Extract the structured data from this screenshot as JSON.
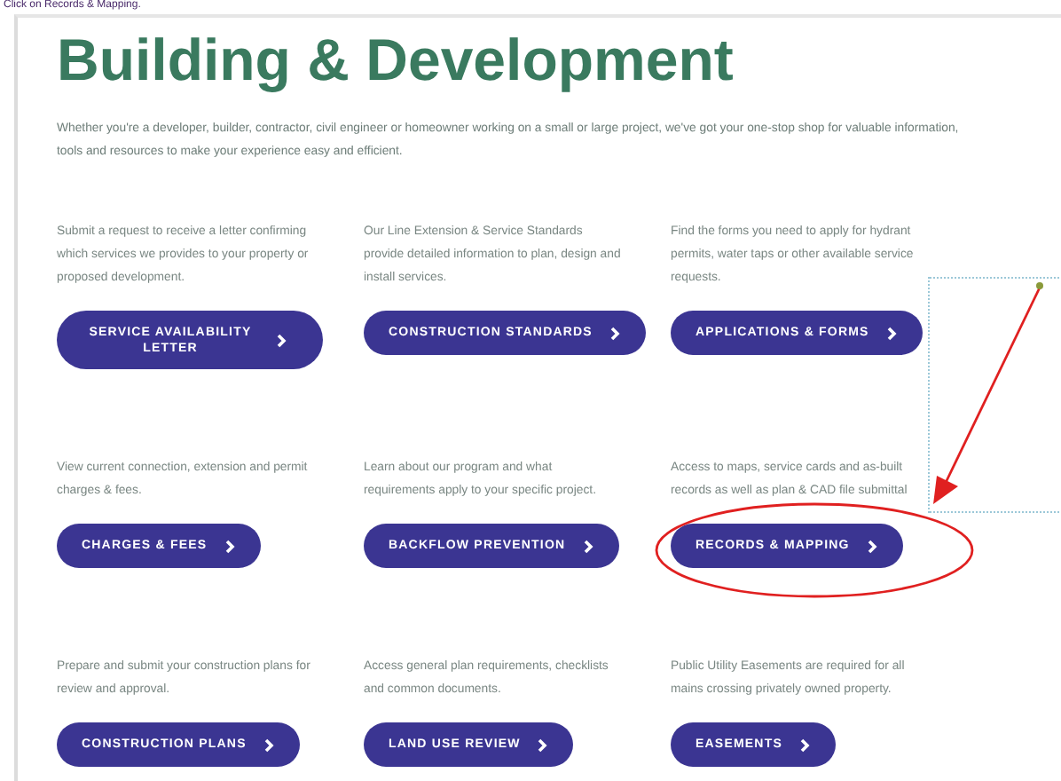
{
  "caption": "Click on Records & Mapping.",
  "title": "Building & Development",
  "intro": "Whether you're a developer, builder, contractor, civil engineer or homeowner working on a small or large project, we've got your one-stop shop for valuable information, tools and resources to make your experience easy and efficient.",
  "cards": [
    {
      "description": "Submit a request to receive a letter confirming which services we provides to your property or proposed development.",
      "button": "SERVICE AVAILABILITY LETTER",
      "highlighted": false
    },
    {
      "description": "Our Line Extension & Service Standards provide detailed information to plan, design and install services.",
      "button": "CONSTRUCTION STANDARDS",
      "highlighted": false
    },
    {
      "description": "Find the forms you need to apply for hydrant permits, water taps or other available service requests.",
      "button": "APPLICATIONS & FORMS",
      "highlighted": false
    },
    {
      "description": "View current connection, extension and permit charges & fees.",
      "button": "CHARGES & FEES",
      "highlighted": false
    },
    {
      "description": "Learn about our program and what requirements apply to your specific project.",
      "button": "BACKFLOW PREVENTION",
      "highlighted": false
    },
    {
      "description": "Access to maps, service cards and as-built records as well as plan & CAD file submittal",
      "button": "RECORDS & MAPPING",
      "highlighted": true
    },
    {
      "description": "Prepare and submit your construction plans for review and approval.",
      "button": "CONSTRUCTION PLANS",
      "highlighted": false
    },
    {
      "description": "Access general plan requirements, checklists and common documents.",
      "button": "LAND USE REVIEW",
      "highlighted": false
    },
    {
      "description": "Public Utility Easements are required for all mains crossing privately owned property.",
      "button": "EASEMENTS",
      "highlighted": false
    }
  ]
}
